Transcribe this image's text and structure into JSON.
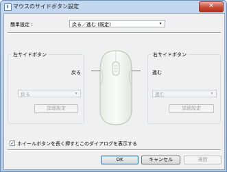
{
  "window": {
    "title": "マウスのサイドボタン設定",
    "close_glyph": "✕"
  },
  "simple": {
    "label": "簡単設定 :",
    "value": "戻る／進む (既定)"
  },
  "left": {
    "group_title": "左サイドボタン",
    "action_label": "戻る",
    "combo_value": "戻る",
    "detail_button": "詳細設定"
  },
  "right": {
    "group_title": "右サイドボタン",
    "action_label": "進む",
    "combo_value": "進む",
    "detail_button": "詳細設定"
  },
  "wheel_option": {
    "label": "ホイールボタンを長く押すとこのダイアログを表示する",
    "checked": true,
    "check_glyph": "✓"
  },
  "footer": {
    "ok": "OK",
    "cancel": "キャンセル",
    "apply": "適用"
  },
  "icons": {
    "dropdown": "▾",
    "title_icon": "mouse-settings-icon"
  }
}
